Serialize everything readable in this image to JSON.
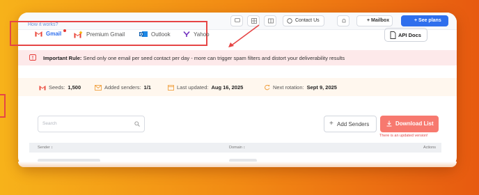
{
  "topbar": {
    "how_link": "How it works?",
    "contact_label": "Contact Us",
    "mailbox_label": "+ Mailbox",
    "see_plans_label": "+ See plans"
  },
  "providers": [
    {
      "label": "Gmail",
      "icon": "gmail-icon",
      "active": true
    },
    {
      "label": "Premium Gmail",
      "icon": "premium-gmail-icon",
      "active": false
    },
    {
      "label": "Outlook",
      "icon": "outlook-icon",
      "active": false
    },
    {
      "label": "Yahoo",
      "icon": "yahoo-icon",
      "active": false
    }
  ],
  "api_docs_label": "API Docs",
  "rule": {
    "title": "Important Rule:",
    "text": "Send only one email per seed contact per day - more can trigger spam filters and distort your deliverability results"
  },
  "stats": {
    "seeds_label": "Seeds:",
    "seeds_value": "1,500",
    "added_label": "Added senders:",
    "added_value": "1/1",
    "updated_label": "Last updated:",
    "updated_value": "Aug 16, 2025",
    "rotation_label": "Next rotation:",
    "rotation_value": "Sept 9, 2025"
  },
  "search": {
    "placeholder": "Search"
  },
  "add_senders_label": "Add Senders",
  "download_label": "Download List",
  "updated_notice": "There is an updated version!",
  "table": {
    "headers": {
      "sender": "Sender ↕",
      "domain": "Domain ↕",
      "actions": "Actions"
    }
  },
  "colors": {
    "accent": "#2f6fed",
    "danger": "#e64545",
    "download": "#f7796f"
  }
}
